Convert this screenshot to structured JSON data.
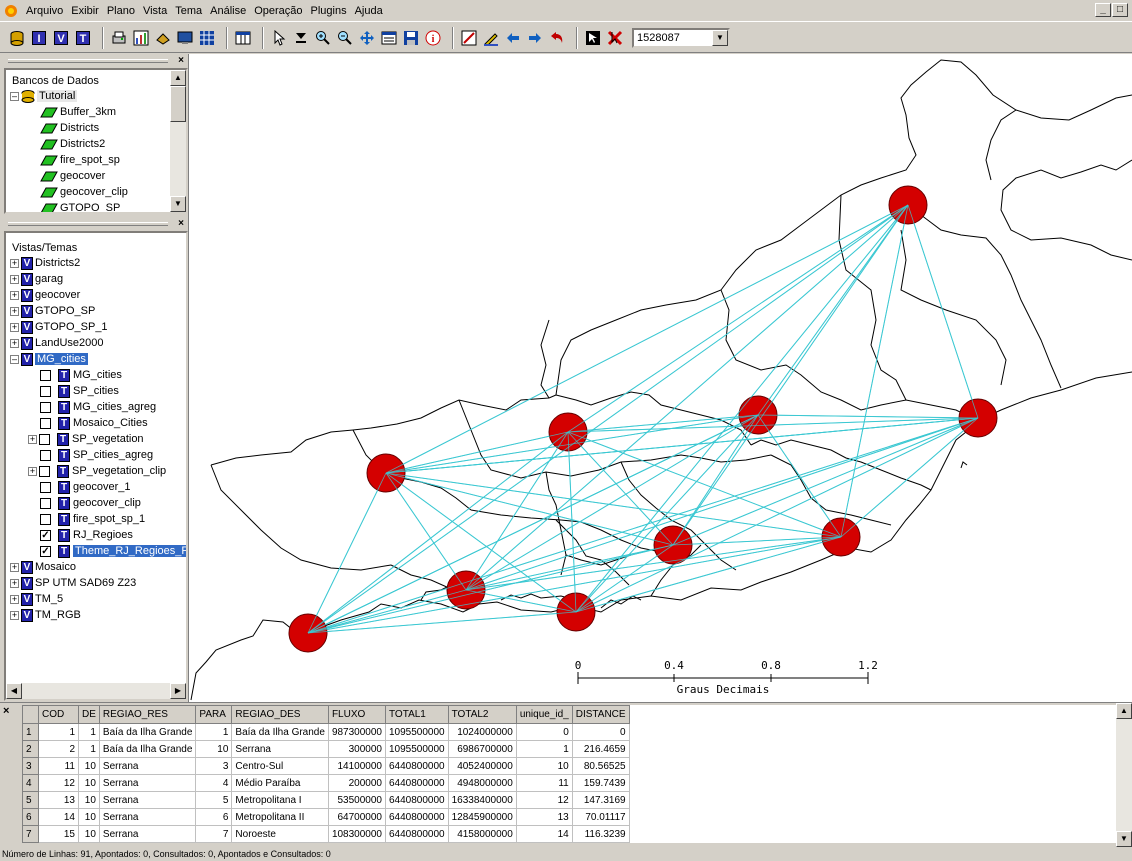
{
  "menu": [
    "Arquivo",
    "Exibir",
    "Plano",
    "Vista",
    "Tema",
    "Análise",
    "Operação",
    "Plugins",
    "Ajuda"
  ],
  "toolbar": {
    "scale_value": "1528087"
  },
  "bancos": {
    "title": "Bancos de Dados",
    "root": "Tutorial",
    "items": [
      "Buffer_3km",
      "Districts",
      "Districts2",
      "fire_spot_sp",
      "geocover",
      "geocover_clip",
      "GTOPO_SP"
    ]
  },
  "vistas": {
    "title": "Vistas/Temas",
    "views_top": [
      "Districts2",
      "garag",
      "geocover",
      "GTOPO_SP",
      "GTOPO_SP_1",
      "LandUse2000",
      "MG_cities"
    ],
    "themes": [
      "MG_cities",
      "SP_cities",
      "MG_cities_agreg",
      "Mosaico_Cities",
      "SP_vegetation",
      "SP_cities_agreg",
      "SP_vegetation_clip",
      "geocover_1",
      "geocover_clip",
      "fire_spot_sp_1",
      "RJ_Regioes",
      "Theme_RJ_Regioes_Fl"
    ],
    "views_bottom": [
      "Mosaico",
      "SP UTM SAD69 Z23",
      "TM_5",
      "TM_RGB"
    ]
  },
  "scalebar": {
    "ticks": [
      "0",
      "0.4",
      "0.8",
      "1.2"
    ],
    "unit": "Graus Decimais"
  },
  "table": {
    "columns": [
      "COD",
      "DE",
      "REGIAO_RES",
      "PARA",
      "REGIAO_DES",
      "FLUXO",
      "TOTAL1",
      "TOTAL2",
      "unique_id_",
      "DISTANCE"
    ],
    "rows": [
      [
        "1",
        "1",
        "1",
        "Baía da Ilha Grande",
        "1",
        "Baía da Ilha Grande",
        "987300000",
        "1095500000",
        "1024000000",
        "0",
        "0"
      ],
      [
        "2",
        "2",
        "1",
        "Baía da Ilha Grande",
        "10",
        "Serrana",
        "300000",
        "1095500000",
        "6986700000",
        "1",
        "216.4659"
      ],
      [
        "3",
        "11",
        "10",
        "Serrana",
        "3",
        "Centro-Sul",
        "14100000",
        "6440800000",
        "4052400000",
        "10",
        "80.56525"
      ],
      [
        "4",
        "12",
        "10",
        "Serrana",
        "4",
        "Médio Paraíba",
        "200000",
        "6440800000",
        "4948000000",
        "11",
        "159.7439"
      ],
      [
        "5",
        "13",
        "10",
        "Serrana",
        "5",
        "Metropolitana I",
        "53500000",
        "6440800000",
        "16338400000",
        "12",
        "147.3169"
      ],
      [
        "6",
        "14",
        "10",
        "Serrana",
        "6",
        "Metropolitana II",
        "64700000",
        "6440800000",
        "12845900000",
        "13",
        "70.01117"
      ],
      [
        "7",
        "15",
        "10",
        "Serrana",
        "7",
        "Noroeste",
        "108300000",
        "6440800000",
        "4158000000",
        "14",
        "116.3239"
      ]
    ]
  },
  "status": "Número de Linhas: 91, Apontados: 0, Consultados: 0, Apontados e Consultados: 0",
  "colors": {
    "node": "#d40000",
    "flow": "#3cc8d2",
    "selection": "#316ac5"
  }
}
